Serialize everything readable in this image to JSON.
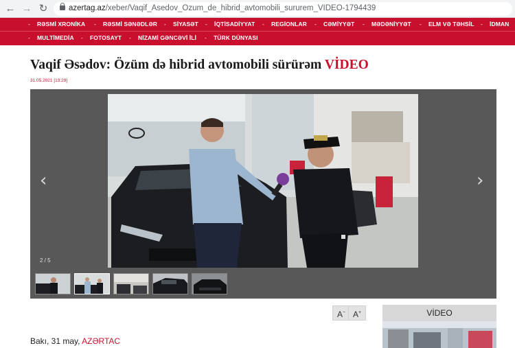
{
  "browser": {
    "back_icon": "arrow-left-icon",
    "forward_icon": "arrow-right-icon",
    "reload_icon": "reload-icon",
    "url_host": "azertag.az",
    "url_path": "/xeber/Vaqif_Asedov_Ozum_de_hibrid_avtomobili_sururem_VIDEO-1794439"
  },
  "menu": {
    "row1": [
      "RƏSMİ XRONİKA",
      "RƏSMİ SƏNƏDLƏR",
      "SİYASƏT",
      "İQTİSADİYYAT",
      "REGİONLAR",
      "CƏMİYYƏT",
      "MƏDƏNİYYƏT",
      "ELM VƏ TƏHSİL",
      "İDMAN"
    ],
    "row2": [
      "MULTİMEDİA",
      "FOTOSAYT",
      "NİZAMİ GƏNCƏVİ İLİ",
      "TÜRK DÜNYASI"
    ]
  },
  "article": {
    "title": "Vaqif Əsədov: Özüm də hibrid avtomobili sürürəm",
    "title_tag": "VİDEO",
    "date": "31.05.2021 [13:29]",
    "lead_place": "Bakı, 31 may,",
    "lead_source": "AZƏRTAC"
  },
  "gallery": {
    "counter": "2 / 5",
    "prev_icon": "chevron-left-icon",
    "next_icon": "chevron-right-icon",
    "thumbnail_count": 5,
    "active_index": 1
  },
  "font_controls": {
    "decrease": "A",
    "decrease_sup": "−",
    "increase": "A",
    "increase_sup": "+"
  },
  "sidebar": {
    "video_heading": "VİDEO"
  }
}
